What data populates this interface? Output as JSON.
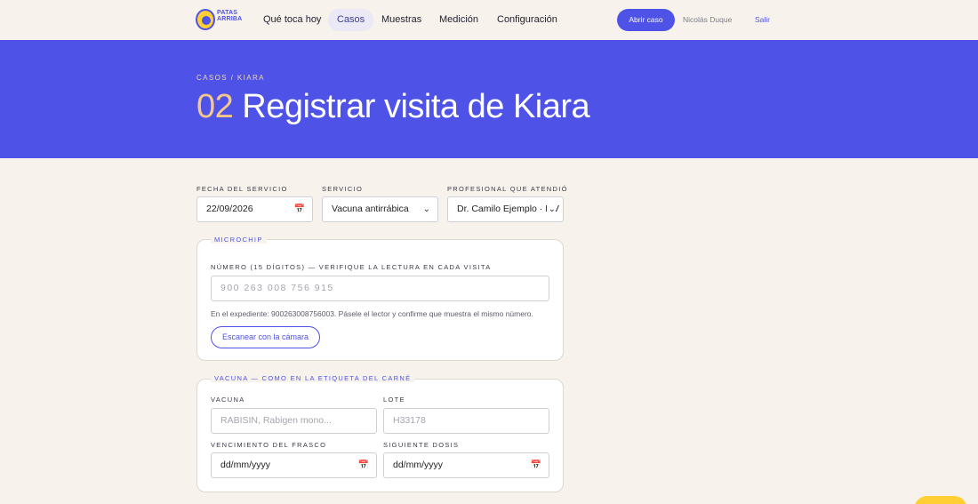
{
  "nav": {
    "logo_text": "PATAS ARRIBA",
    "items": [
      "Qué toca hoy",
      "Casos",
      "Muestras",
      "Medición",
      "Configuración"
    ],
    "open_case": "Abrir caso",
    "user": "Nicolás Duque",
    "logout": "Salir"
  },
  "hero": {
    "breadcrumb": "CASOS / KIARA",
    "step": "02",
    "title": "Registrar visita de Kiara"
  },
  "form": {
    "date_label": "FECHA DEL SERVICIO",
    "date_value": "22/09/2026",
    "service_label": "SERVICIO",
    "service_value": "Vacuna antirrábica",
    "professional_label": "PROFESIONAL QUE ATENDIÓ",
    "professional_value": "Dr. Camilo Ejemplo · MV"
  },
  "microchip": {
    "legend": "MICROCHIP",
    "label": "NÚMERO (15 DÍGITOS) — VERIFIQUE LA LECTURA EN CADA VISITA",
    "placeholder": "900 263 008 756 915",
    "hint": "En el expediente: 900263008756003. Pásele el lector y confirme que muestra el mismo número.",
    "scan_button": "Escanear con la cámara"
  },
  "vaccine": {
    "legend": "VACUNA — COMO EN LA ETIQUETA DEL CARNÉ",
    "vaccine_label": "VACUNA",
    "vaccine_placeholder": "RABISIN, Rabigen mono...",
    "lot_label": "LOTE",
    "lot_placeholder": "H33178",
    "expiry_label": "VENCIMIENTO DEL FRASCO",
    "expiry_placeholder": "dd/mm/yyyy",
    "next_label": "SIGUIENTE DOSIS",
    "next_placeholder": "dd/mm/yyyy"
  },
  "colors": {
    "accent": "#4e52e6",
    "background": "#f7f3ec",
    "highlight": "#f5c88a",
    "fab": "#ffcf33"
  },
  "icons": {
    "calendar": "calendar-icon",
    "chevron": "chevron-down-icon"
  }
}
